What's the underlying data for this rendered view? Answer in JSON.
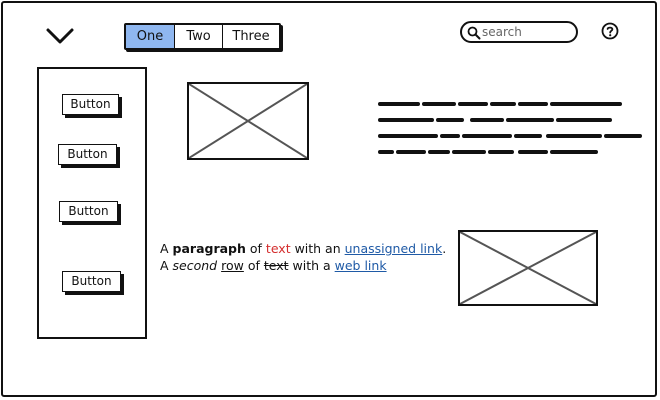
{
  "tabs": [
    {
      "label": "One",
      "active": true
    },
    {
      "label": "Two",
      "active": false
    },
    {
      "label": "Three",
      "active": false
    }
  ],
  "search": {
    "placeholder": "search",
    "value": ""
  },
  "sidebar": {
    "buttons": [
      {
        "label": "Button"
      },
      {
        "label": "Button"
      },
      {
        "label": "Button"
      },
      {
        "label": "Button"
      }
    ]
  },
  "paragraph": {
    "line1": {
      "t1": "A ",
      "bold": "paragraph",
      "t2": " of ",
      "red": "text",
      "t3": " with an ",
      "link": "unassigned link",
      "t4": "."
    },
    "line2": {
      "t1": "A ",
      "italic": "second",
      "t2": " ",
      "underline": "row",
      "t3": " of ",
      "strike": "text",
      "t4": " with a ",
      "link": "web link"
    }
  },
  "colors": {
    "active_tab": "#8fb7f0",
    "text_red": "#d42d2d",
    "link_blue": "#1f5aa6",
    "ink": "#111111"
  },
  "icons": [
    "chevron-down-icon",
    "search-icon",
    "help-icon",
    "image-placeholder-icon"
  ]
}
